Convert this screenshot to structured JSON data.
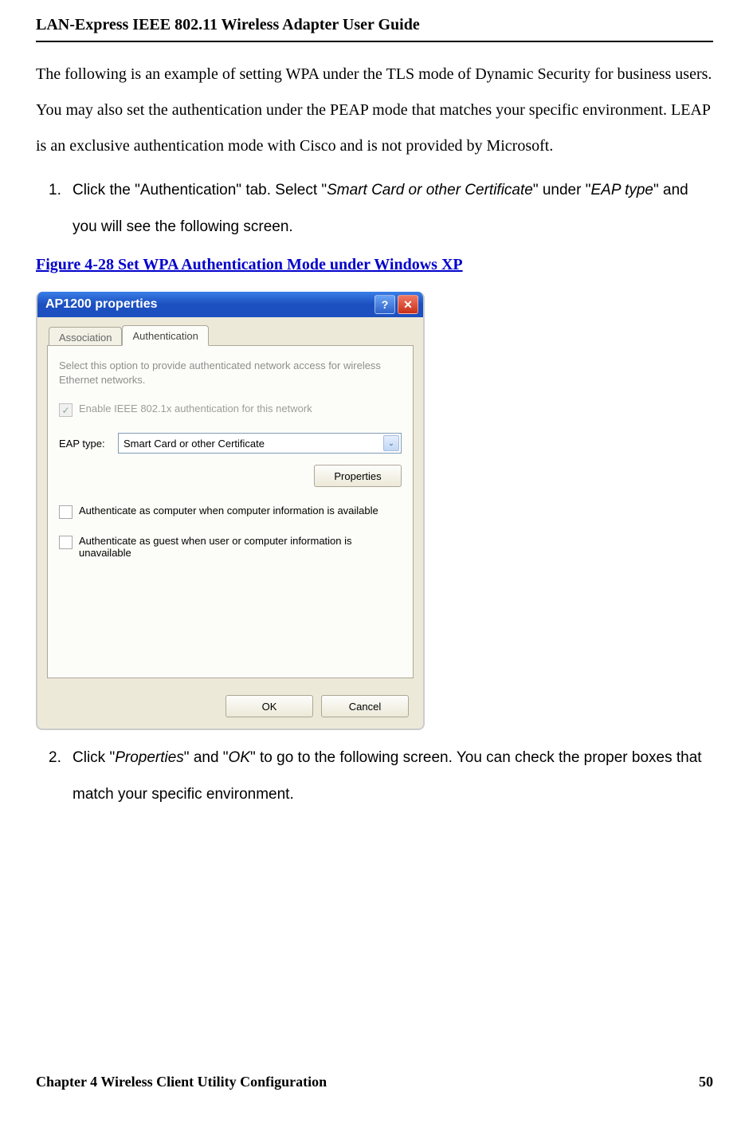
{
  "header": {
    "title": "LAN-Express IEEE 802.11 Wireless Adapter User Guide"
  },
  "intro": "The following is an example of setting WPA under the TLS mode of Dynamic Security for business users. You may also set the authentication under the PEAP mode that matches your specific environment. LEAP is an exclusive authentication mode with Cisco and is not provided by Microsoft.",
  "steps": {
    "s1_num": "1.",
    "s1_a": "Click the \"Authentication\" tab. Select \"",
    "s1_b": "Smart Card or other Certificate",
    "s1_c": "\" under \"",
    "s1_d": "EAP type",
    "s1_e": "\" and you will see the following screen.",
    "s2_num": "2.",
    "s2_a": "Click \"",
    "s2_b": "Properties",
    "s2_c": "\" and \"",
    "s2_d": "OK",
    "s2_e": "\" to go to the following screen. You can check the proper boxes that match your specific environment."
  },
  "figure_caption": "Figure 4-28 Set WPA Authentication Mode under Windows XP",
  "dialog": {
    "title": "AP1200 properties",
    "help_btn": "?",
    "close_btn": "✕",
    "tabs": {
      "assoc": "Association",
      "auth": "Authentication"
    },
    "description": "Select this option to provide authenticated network access for wireless Ethernet networks.",
    "enable_chk": "Enable IEEE 802.1x authentication for this network",
    "eap_label": "EAP type:",
    "eap_value": "Smart Card or other Certificate",
    "properties_btn": "Properties",
    "chk_computer": "Authenticate as computer when computer information is available",
    "chk_guest": "Authenticate as guest when user or computer information is unavailable",
    "ok_btn": "OK",
    "cancel_btn": "Cancel",
    "checkmark": "✓",
    "dd_arrow": "⌄"
  },
  "footer": {
    "chapter": "Chapter 4 Wireless Client Utility Configuration",
    "pagenum": "50"
  }
}
